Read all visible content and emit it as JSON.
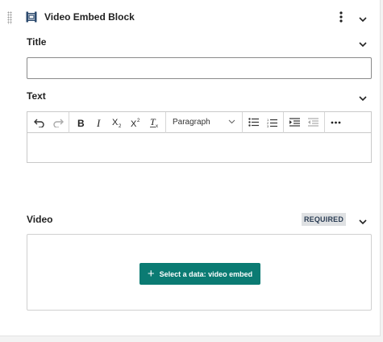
{
  "block": {
    "title": "Video Embed Block",
    "icon": "video-embed-icon",
    "menu_icon": "kebab-menu-icon"
  },
  "fields": {
    "title": {
      "label": "Title",
      "value": ""
    },
    "text": {
      "label": "Text",
      "paragraph_format": "Paragraph",
      "toolbar_icons": [
        "undo-icon",
        "redo-icon",
        "bold-icon",
        "italic-icon",
        "subscript-icon",
        "superscript-icon",
        "remove-format-icon",
        "bulleted-list-icon",
        "numbered-list-icon",
        "indent-icon",
        "outdent-icon",
        "more-icon"
      ]
    },
    "video": {
      "label": "Video",
      "required_badge": "REQUIRED",
      "select_button": "Select a data: video embed"
    }
  },
  "colors": {
    "accent_button": "#0b7b73",
    "required_badge_bg": "#dfe1e3",
    "required_badge_text": "#2c3e55"
  }
}
